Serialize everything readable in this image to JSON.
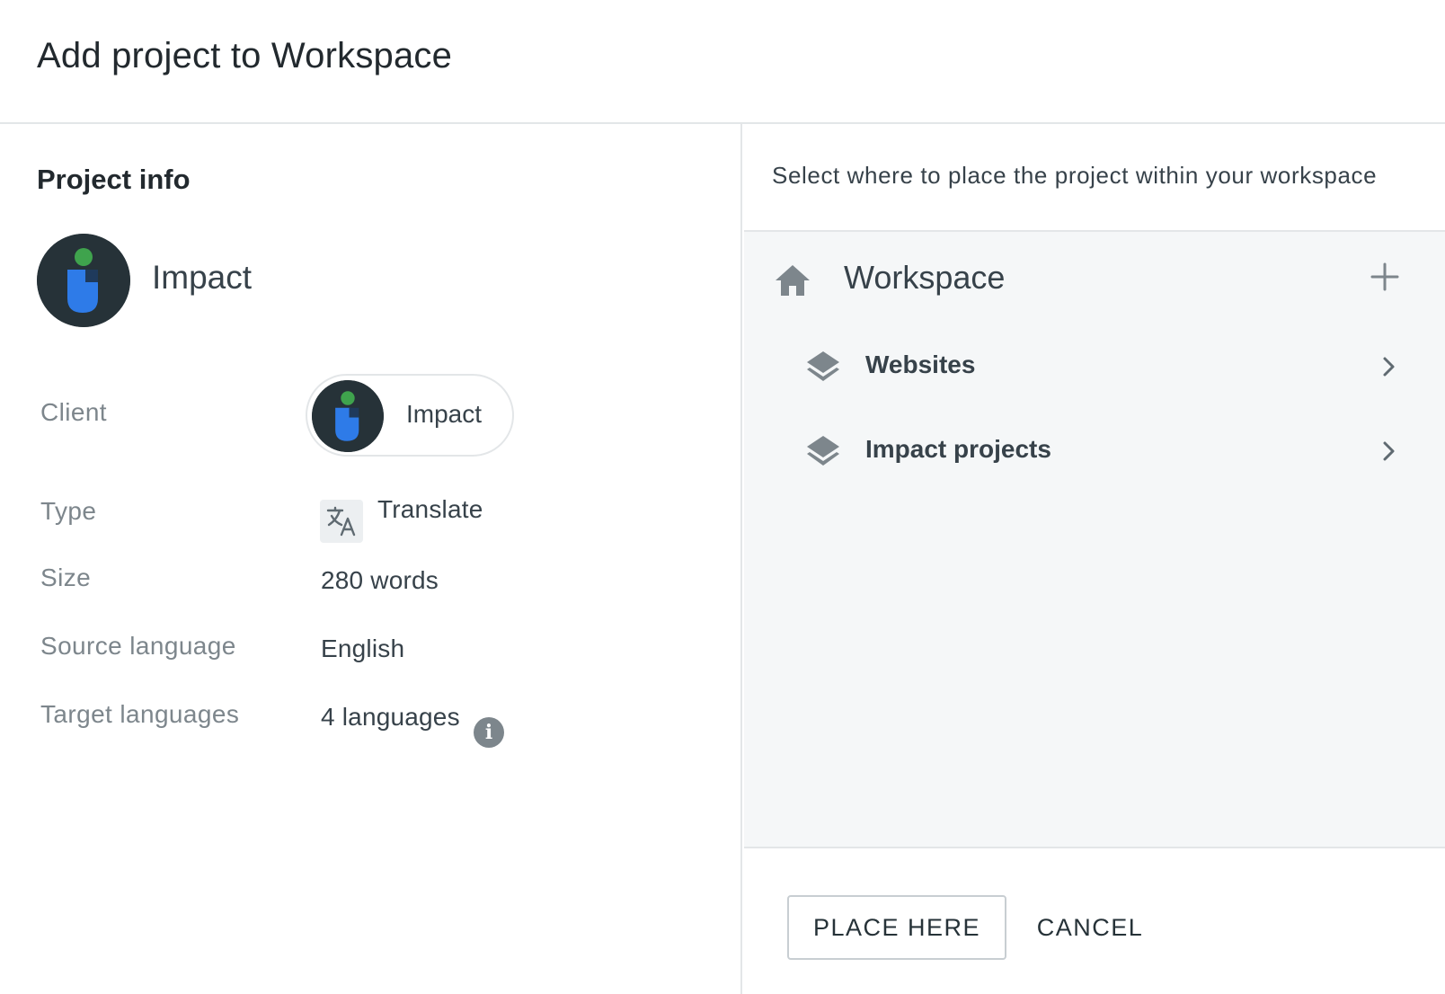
{
  "dialog": {
    "title": "Add project to Workspace"
  },
  "project_info": {
    "section_title": "Project info",
    "project_name": "Impact",
    "logo_icon": "impact-logo-icon",
    "fields": {
      "client": {
        "label": "Client",
        "value": "Impact"
      },
      "type": {
        "label": "Type",
        "value": "Translate",
        "icon": "translate-icon"
      },
      "size": {
        "label": "Size",
        "value": "280 words"
      },
      "source_language": {
        "label": "Source language",
        "value": "English"
      },
      "target_languages": {
        "label": "Target languages",
        "value": "4 languages",
        "icon": "info-icon"
      }
    }
  },
  "workspace_tree": {
    "instruction": "Select where to place the project within your workspace",
    "root": {
      "label": "Workspace",
      "icon": "home-icon",
      "action_icon": "plus-icon"
    },
    "items": [
      {
        "label": "Websites",
        "icon": "layers-icon",
        "action_icon": "chevron-right-icon"
      },
      {
        "label": "Impact projects",
        "icon": "layers-icon",
        "action_icon": "chevron-right-icon"
      }
    ]
  },
  "footer": {
    "place_label": "PLACE HERE",
    "cancel_label": "CANCEL"
  },
  "colors": {
    "logo_bg": "#263238",
    "logo_green": "#3fa34d",
    "logo_blue": "#2e7be8",
    "icon_gray": "#7d868c",
    "tree_bg": "#f5f7f8"
  }
}
